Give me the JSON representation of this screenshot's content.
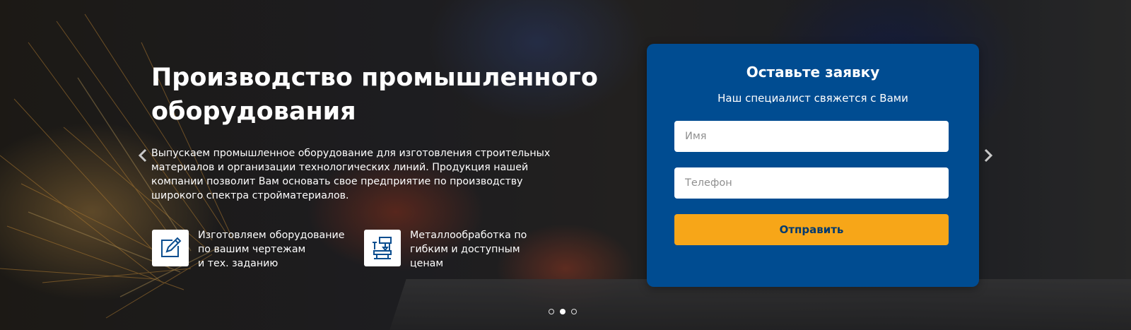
{
  "hero": {
    "title": "Производство промышленного оборудования",
    "description": "Выпускаем промышленное оборудование для изготовления строительных материалов и организации технологических линий. Продукция нашей компании позволит Вам основать свое предприятие по производству широкого спектра стройматериалов.",
    "features": [
      {
        "icon": "pencil-edit-icon",
        "text": "Изготовляем оборудование\nпо вашим чертежам\nи тех. заданию"
      },
      {
        "icon": "machine-tool-icon",
        "text": "Металлообработка по\nгибким и доступным\nценам"
      }
    ]
  },
  "slider": {
    "slides": 3,
    "active_index": 1
  },
  "form": {
    "title": "Оставьте заявку",
    "subtitle": "Наш специалист свяжется с Вами",
    "name_placeholder": "Имя",
    "phone_placeholder": "Телефон",
    "submit_label": "Отправить"
  },
  "colors": {
    "form_background": "#004c91",
    "button_background": "#f7a618",
    "button_text": "#003a70",
    "text": "#ffffff"
  }
}
